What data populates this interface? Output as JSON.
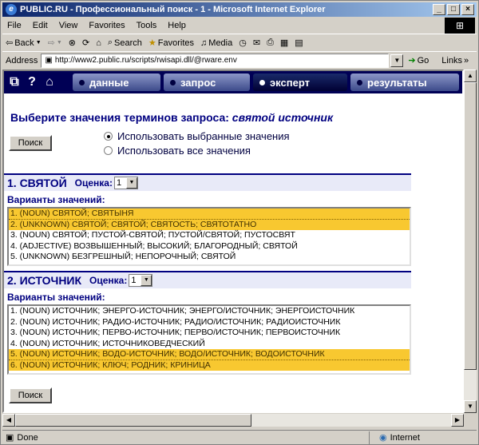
{
  "window": {
    "title": "PUBLIC.RU - Профессиональный поиск - 1 - Microsoft Internet Explorer",
    "menu": [
      "File",
      "Edit",
      "View",
      "Favorites",
      "Tools",
      "Help"
    ]
  },
  "toolbar": {
    "back": "Back",
    "search": "Search",
    "favorites": "Favorites",
    "media": "Media"
  },
  "address": {
    "label": "Address",
    "url": "http://www2.public.ru/scripts/rwisapi.dll/@rware.env",
    "go": "Go",
    "links": "Links"
  },
  "status": {
    "text": "Done",
    "zone": "Internet"
  },
  "nav": {
    "tabs": [
      {
        "label": "данные",
        "active": false
      },
      {
        "label": "запрос",
        "active": false
      },
      {
        "label": "эксперт",
        "active": true
      },
      {
        "label": "результаты",
        "active": false
      }
    ]
  },
  "page": {
    "heading_prefix": "Выберите значения терминов запроса:",
    "heading_query": "святой источник",
    "search_button": "Поиск",
    "radio_selected": "Использовать выбранные значения",
    "radio_all": "Использовать все значения",
    "variants_label": "Варианты значений:",
    "score_label": "Оценка:"
  },
  "terms": [
    {
      "title": "1. СВЯТОЙ",
      "score": "1",
      "variants": [
        {
          "text": "1. (NOUN) СВЯТОЙ; СВЯТЫНЯ",
          "selected": true
        },
        {
          "text": "2. (UNKNOWN) СВЯТОЙ; СВЯТОЙ; СВЯТОСТЬ; СВЯТОТАТНО",
          "selected": true
        },
        {
          "text": "3. (NOUN) СВЯТОЙ; ПУСТОЙ-СВЯТОЙ; ПУСТОЙ/СВЯТОЙ; ПУСТОСВЯТ",
          "selected": false
        },
        {
          "text": "4. (ADJECTIVE) ВОЗВЫШЕННЫЙ; ВЫСОКИЙ; БЛАГОРОДНЫЙ; СВЯТОЙ",
          "selected": false
        },
        {
          "text": "5. (UNKNOWN) БЕЗГРЕШНЫЙ; НЕПОРОЧНЫЙ; СВЯТОЙ",
          "selected": false
        }
      ]
    },
    {
      "title": "2. ИСТОЧНИК",
      "score": "1",
      "variants": [
        {
          "text": "1. (NOUN) ИСТОЧНИК; ЭНЕРГО-ИСТОЧНИК; ЭНЕРГО/ИСТОЧНИК; ЭНЕРГОИСТОЧНИК",
          "selected": false
        },
        {
          "text": "2. (NOUN) ИСТОЧНИК; РАДИО-ИСТОЧНИК; РАДИО/ИСТОЧНИК; РАДИОИСТОЧНИК",
          "selected": false
        },
        {
          "text": "3. (NOUN) ИСТОЧНИК; ПЕРВО-ИСТОЧНИК; ПЕРВО/ИСТОЧНИК; ПЕРВОИСТОЧНИК",
          "selected": false
        },
        {
          "text": "4. (NOUN) ИСТОЧНИК; ИСТОЧНИКОВЕДЧЕСКИЙ",
          "selected": false
        },
        {
          "text": "5. (NOUN) ИСТОЧНИК; ВОДО-ИСТОЧНИК; ВОДО/ИСТОЧНИК; ВОДОИСТОЧНИК",
          "selected": true
        },
        {
          "text": "6. (NOUN) ИСТОЧНИК; КЛЮЧ; РОДНИК; КРИНИЦА",
          "selected": true
        }
      ]
    }
  ]
}
